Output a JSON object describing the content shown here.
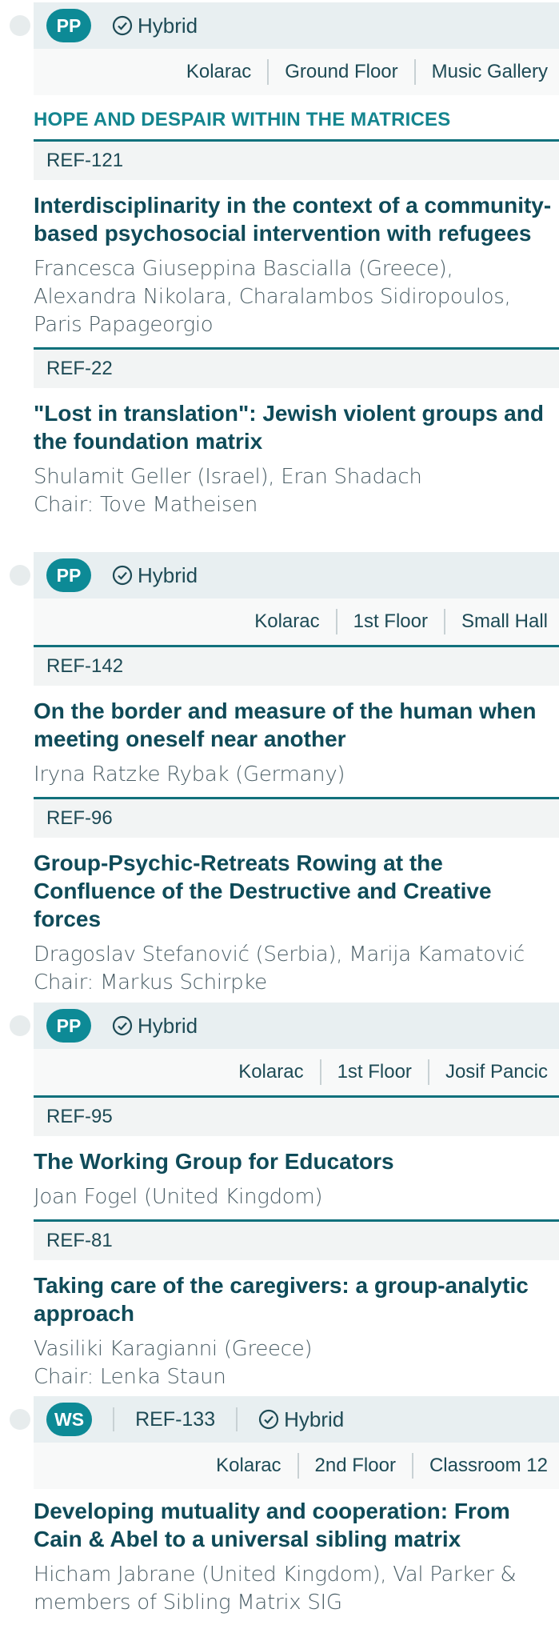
{
  "sessions": [
    {
      "type": "PP",
      "hybrid": "Hybrid",
      "location": [
        "Kolarac",
        "Ground Floor",
        "Music Gallery"
      ],
      "track": "HOPE AND DESPAIR WITHIN THE MATRICES",
      "papers": [
        {
          "ref": "REF-121",
          "title": "Interdisciplinarity in the context of a community-based psychosocial intervention with refugees",
          "authors": "Francesca Giuseppina Bascialla (Greece), Alexandra Nikolara, Charalambos Sidiropoulos, Paris Papageorgio"
        },
        {
          "ref": "REF-22",
          "title": "\"Lost in translation\": Jewish violent groups and the foundation matrix",
          "authors": "Shulamit Geller (Israel), Eran Shadach",
          "chair": "Chair: Tove Matheisen"
        }
      ]
    },
    {
      "type": "PP",
      "hybrid": "Hybrid",
      "location": [
        "Kolarac",
        "1st Floor",
        "Small Hall"
      ],
      "papers": [
        {
          "ref": "REF-142",
          "title": "On the border and measure of the human when meeting oneself near another",
          "authors": "Iryna Ratzke Rybak (Germany)"
        },
        {
          "ref": "REF-96",
          "title": "Group-Psychic-Retreats  Rowing at the Confluence of the Destructive and Creative forces",
          "authors": "Dragoslav Stefanović (Serbia), Marija Kamatović",
          "chair": "Chair: Markus Schirpke"
        }
      ]
    },
    {
      "type": "PP",
      "hybrid": "Hybrid",
      "location": [
        "Kolarac",
        "1st Floor",
        "Josif Pancic"
      ],
      "papers": [
        {
          "ref": "REF-95",
          "title": "The Working Group for Educators",
          "authors": "Joan Fogel (United Kingdom)"
        },
        {
          "ref": "REF-81",
          "title": "Taking care of the caregivers: a group-analytic approach",
          "authors": "Vasiliki Karagianni (Greece)",
          "chair": "Chair: Lenka Staun"
        }
      ]
    },
    {
      "type": "WS",
      "ref": "REF-133",
      "hybrid": "Hybrid",
      "location": [
        "Kolarac",
        "2nd Floor",
        "Classroom 12"
      ],
      "papers": [
        {
          "title": "Developing mutuality and cooperation: From Cain & Abel to a universal sibling matrix",
          "authors": "Hicham Jabrane (United Kingdom), Val Parker & members of Sibling Matrix SIG"
        }
      ]
    }
  ]
}
